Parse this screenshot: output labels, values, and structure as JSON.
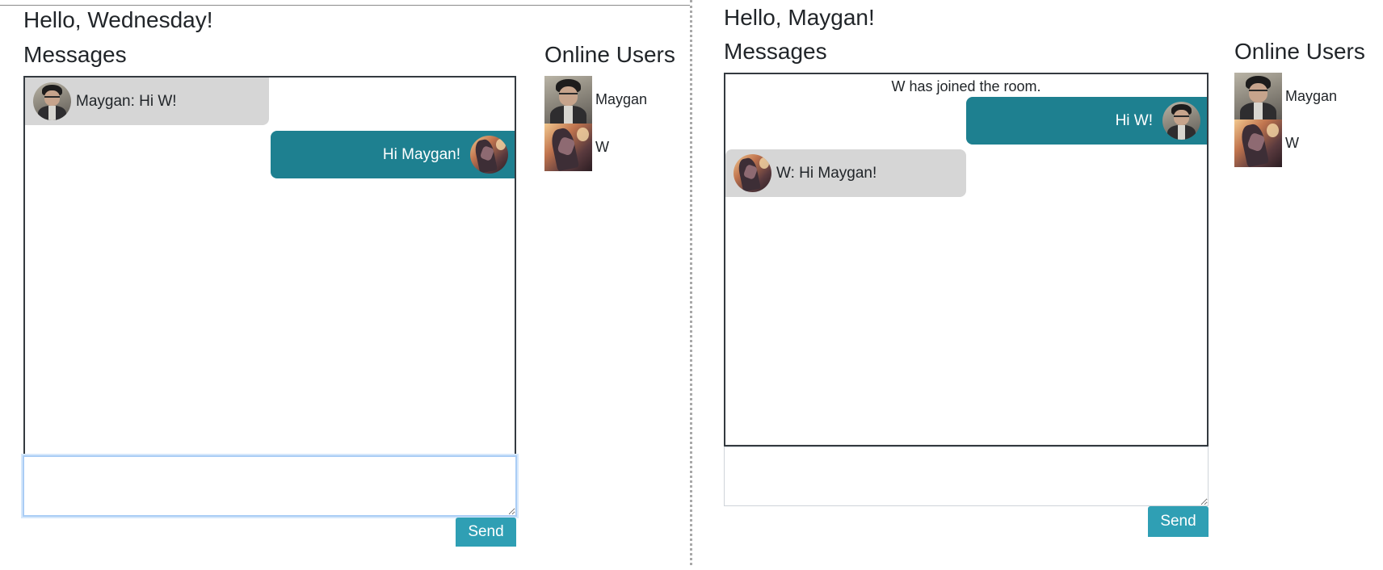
{
  "left_window": {
    "greeting": "Hello, Wednesday!",
    "messages_title": "Messages",
    "online_title": "Online Users",
    "messages": [
      {
        "kind": "incoming",
        "text": "Maygan: Hi W!",
        "avatar": "maygan-avatar"
      },
      {
        "kind": "outgoing",
        "text": "Hi Maygan!",
        "avatar": "w-avatar"
      }
    ],
    "compose_value": "",
    "send_label": "Send",
    "online_users": [
      {
        "name": "Maygan",
        "avatar": "maygan-avatar"
      },
      {
        "name": "W",
        "avatar": "w-avatar"
      }
    ]
  },
  "right_window": {
    "greeting": "Hello, Maygan!",
    "messages_title": "Messages",
    "online_title": "Online Users",
    "system_note": "W has joined the room.",
    "messages": [
      {
        "kind": "outgoing",
        "text": "Hi W!",
        "avatar": "maygan-avatar"
      },
      {
        "kind": "incoming",
        "text": "W: Hi Maygan!",
        "avatar": "w-avatar"
      }
    ],
    "compose_value": "",
    "send_label": "Send",
    "online_users": [
      {
        "name": "Maygan",
        "avatar": "maygan-avatar"
      },
      {
        "name": "W",
        "avatar": "w-avatar"
      }
    ]
  },
  "colors": {
    "outgoing_bubble": "#1e8090",
    "incoming_bubble": "#d6d6d6",
    "send_button": "#2f9fb4",
    "focus_ring": "#aacdf5"
  }
}
